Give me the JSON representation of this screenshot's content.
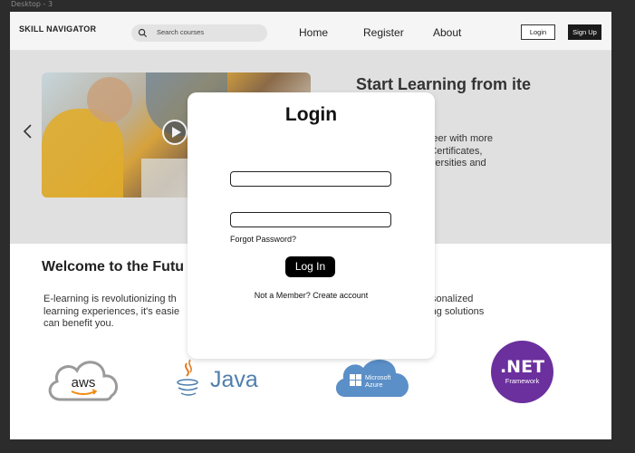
{
  "canvas": {
    "frame_label": "Desktop - 3"
  },
  "header": {
    "brand": "SKILL NAVIGATOR",
    "search_placeholder": "Search courses",
    "nav": {
      "home": "Home",
      "register": "Register",
      "about": "About"
    },
    "login_label": "Login",
    "signup_label": "Sign Up"
  },
  "hero": {
    "title": "Start Learning from ite",
    "description_lines": [
      "advance your career with more",
      "es, Professional Certificates,",
      "n world-class universities and"
    ],
    "prev_icon": "chevron-left-icon"
  },
  "welcome": {
    "title": "Welcome to the Futu",
    "description_lines": [
      "E-learning is revolutionizing th                                                           , accessible, and personalized",
      "learning experiences, it's easie                                                           ver how our e-learning solutions",
      "can benefit you."
    ]
  },
  "logos": {
    "aws": "aws",
    "java": "Java",
    "azure_line1": "Microsoft",
    "azure_line2": "Azure",
    "net_line1": ".NET",
    "net_line2": "Framework"
  },
  "login_modal": {
    "title": "Login",
    "forgot_password": "Forgot Password?",
    "submit_label": "Log In",
    "create_account": "Not a Member? Create account"
  },
  "colors": {
    "canvas_bg": "#2c2c2c",
    "nav_bg": "#f5f5f5",
    "hero_bg": "#e0e0e0",
    "button_dark": "#1b1b1b",
    "net_purple": "#6b2f9e",
    "azure_blue": "#5b8fc7"
  }
}
